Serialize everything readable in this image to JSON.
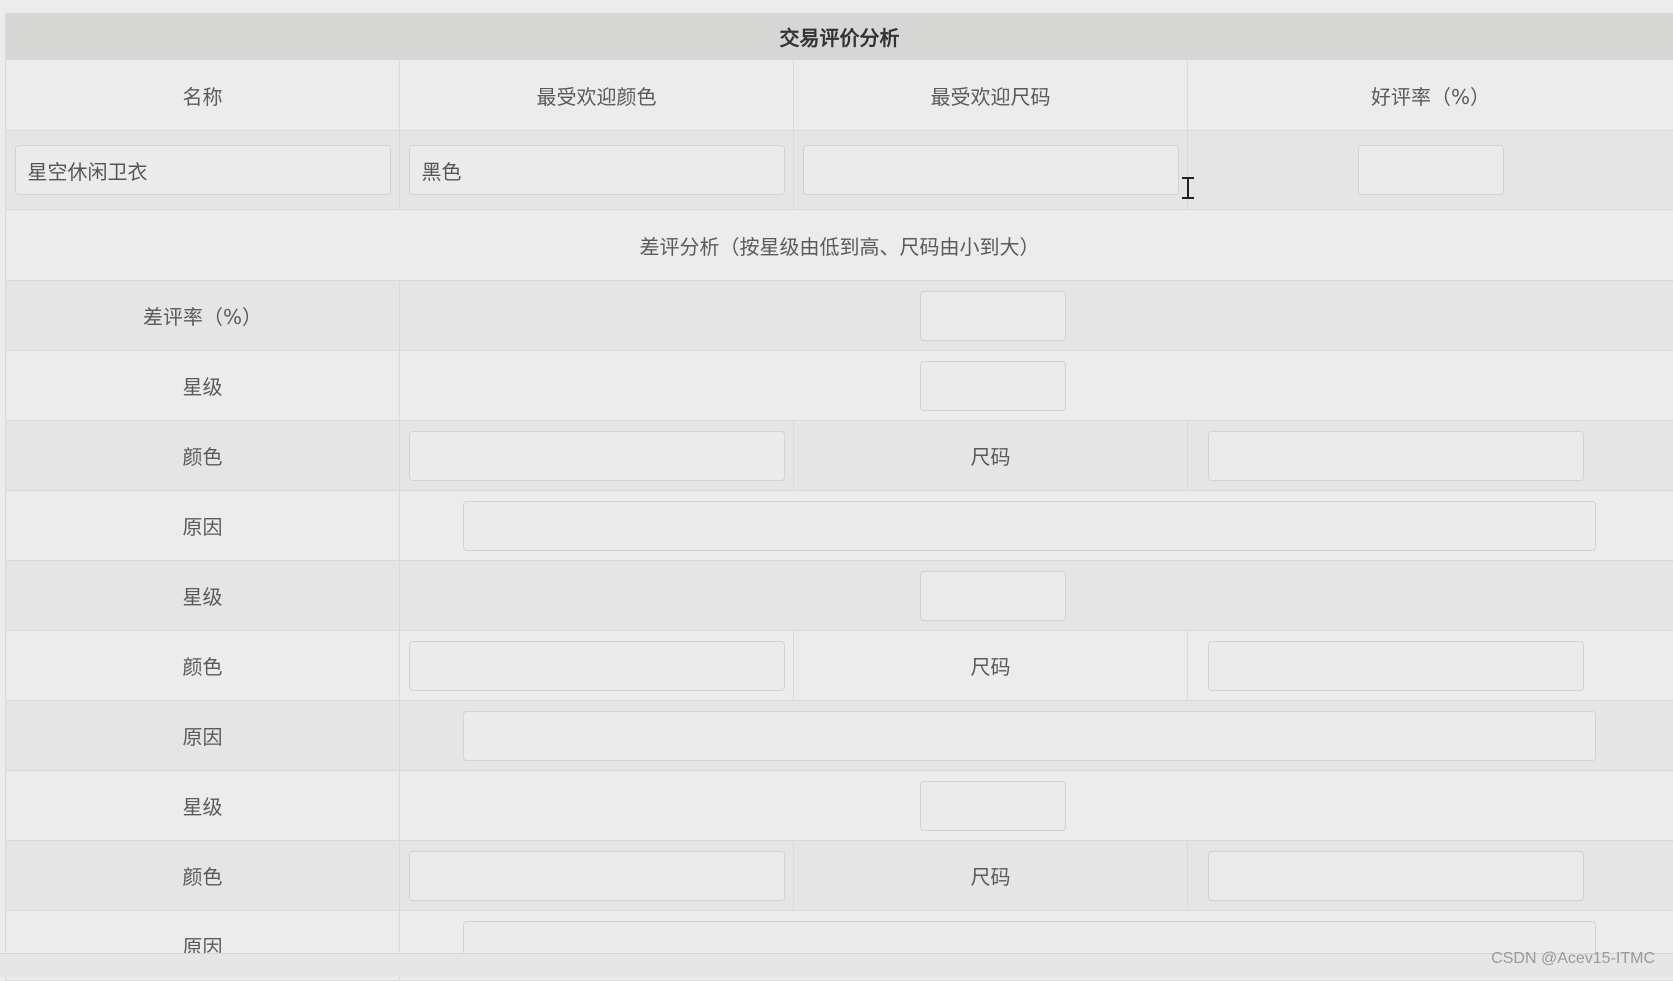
{
  "title": "交易评价分析",
  "header": {
    "name": "名称",
    "popular_color": "最受欢迎颜色",
    "popular_size": "最受欢迎尺码",
    "good_rate": "好评率（%）"
  },
  "values": {
    "name": "星空休闲卫衣",
    "popular_color": "黑色",
    "popular_size": "",
    "good_rate": ""
  },
  "section_title": "差评分析（按星级由低到高、尺码由小到大）",
  "bad_rate_label": "差评率（%）",
  "bad_rate_value": "",
  "labels": {
    "star": "星级",
    "color": "颜色",
    "size": "尺码",
    "reason": "原因"
  },
  "groups": [
    {
      "star": "",
      "color": "",
      "size": "",
      "reason": ""
    },
    {
      "star": "",
      "color": "",
      "size": "",
      "reason": ""
    },
    {
      "star": "",
      "color": "",
      "size": "",
      "reason": ""
    }
  ],
  "watermark": "CSDN @Acev15-ITMC"
}
